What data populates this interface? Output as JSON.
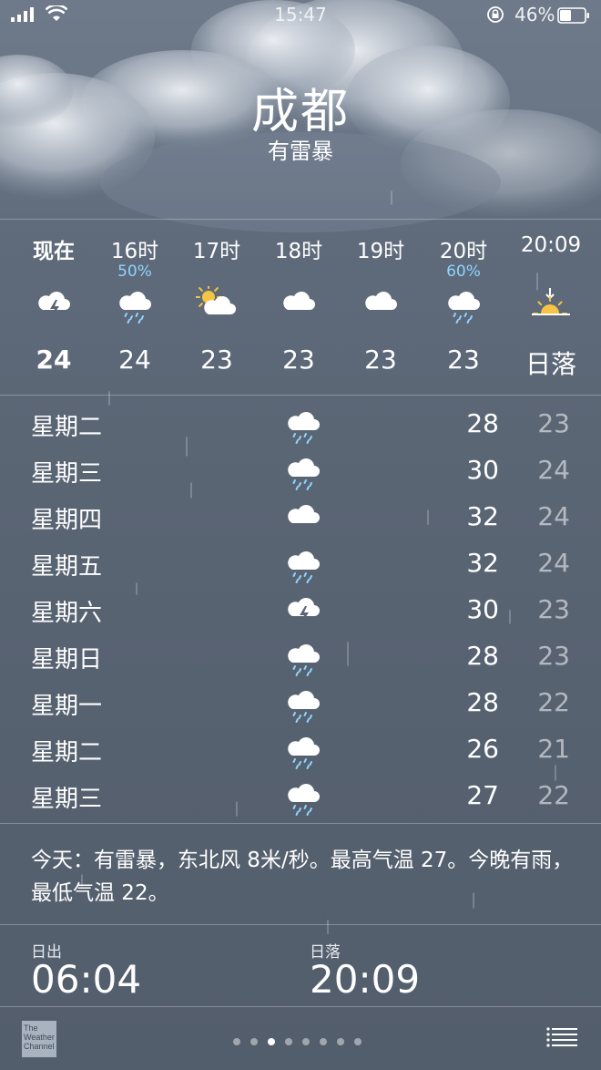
{
  "status_bar": {
    "time": "15:47",
    "battery_percent": "46%",
    "battery_level": 0.46
  },
  "location": {
    "city": "成都",
    "condition": "有雷暴"
  },
  "hourly": [
    {
      "label": "现在",
      "pop": "",
      "icon": "thunderstorm-icon",
      "temp": "24",
      "bold": true
    },
    {
      "label": "16时",
      "pop": "50%",
      "icon": "rain-icon",
      "temp": "24",
      "bold": false
    },
    {
      "label": "17时",
      "pop": "",
      "icon": "partly-sunny-icon",
      "temp": "23",
      "bold": false
    },
    {
      "label": "18时",
      "pop": "",
      "icon": "cloud-icon",
      "temp": "23",
      "bold": false
    },
    {
      "label": "19时",
      "pop": "",
      "icon": "cloud-icon",
      "temp": "23",
      "bold": false
    },
    {
      "label": "20时",
      "pop": "60%",
      "icon": "rain-icon",
      "temp": "23",
      "bold": false
    },
    {
      "label": "20:09",
      "pop": "",
      "icon": "sunset-icon",
      "temp": "日落",
      "bold": false
    }
  ],
  "daily": [
    {
      "day": "星期二",
      "icon": "rain-icon",
      "high": "28",
      "low": "23"
    },
    {
      "day": "星期三",
      "icon": "rain-icon",
      "high": "30",
      "low": "24"
    },
    {
      "day": "星期四",
      "icon": "cloud-icon",
      "high": "32",
      "low": "24"
    },
    {
      "day": "星期五",
      "icon": "rain-icon",
      "high": "32",
      "low": "24"
    },
    {
      "day": "星期六",
      "icon": "thunderstorm-icon",
      "high": "30",
      "low": "23"
    },
    {
      "day": "星期日",
      "icon": "rain-icon",
      "high": "28",
      "low": "23"
    },
    {
      "day": "星期一",
      "icon": "rain-icon",
      "high": "28",
      "low": "22"
    },
    {
      "day": "星期二",
      "icon": "rain-icon",
      "high": "26",
      "low": "21"
    },
    {
      "day": "星期三",
      "icon": "rain-icon",
      "high": "27",
      "low": "22"
    }
  ],
  "summary": "今天：有雷暴，东北风 8米/秒。最高气温 27。今晚有雨，最低气温 22。",
  "sun": {
    "sunrise_label": "日出",
    "sunrise_value": "06:04",
    "sunset_label": "日落",
    "sunset_value": "20:09"
  },
  "footer": {
    "logo_text": [
      "The",
      "Weather",
      "Channel"
    ],
    "page_count": 8,
    "active_page": 2
  },
  "colors": {
    "precip": "#8fd3ff",
    "sun": "#f6c445",
    "low_temp": "rgba(255,255,255,0.55)"
  }
}
